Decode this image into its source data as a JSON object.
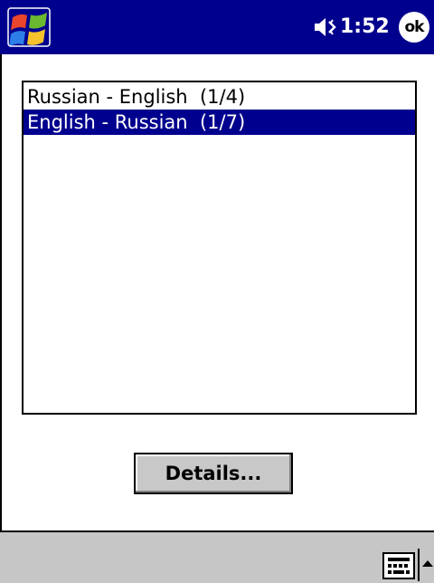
{
  "titlebar": {
    "start_icon": "windows-flag-icon",
    "volume_icon": "speaker-muted-icon",
    "time": "1:52",
    "ok_label": "ok",
    "color": "#00008e"
  },
  "dictionary_list": {
    "items": [
      {
        "label": "Russian - English  (1/4)",
        "selected": false
      },
      {
        "label": "English - Russian  (1/7)",
        "selected": true
      }
    ],
    "selection_color": "#00008e"
  },
  "details_button": {
    "label": "Details..."
  },
  "menubar": {
    "input_icon": "keyboard-icon",
    "sip_arrow_icon": "up-arrow-icon",
    "background": "#c6c6c6"
  }
}
